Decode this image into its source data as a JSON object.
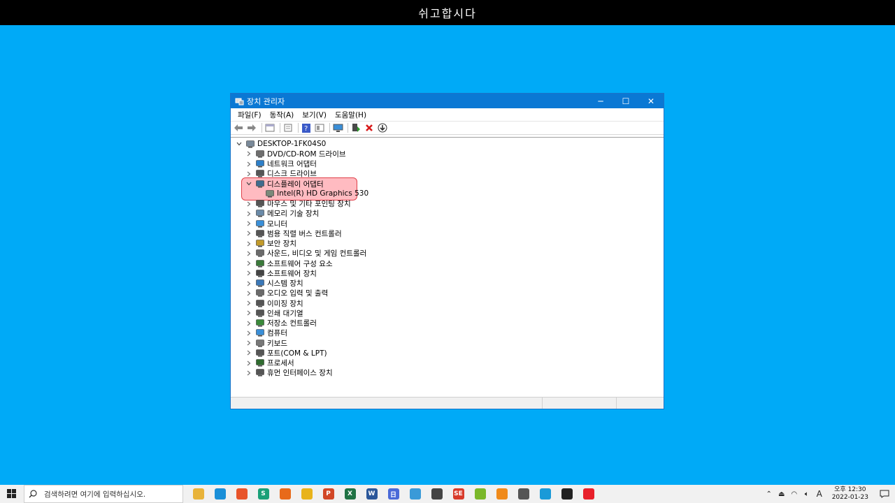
{
  "banner": {
    "text": "쉬고합시다"
  },
  "window": {
    "title": "장치 관리자",
    "controls": {
      "minimize": "─",
      "maximize": "☐",
      "close": "✕"
    }
  },
  "menu": [
    "파일(F)",
    "동작(A)",
    "보기(V)",
    "도움말(H)"
  ],
  "toolbar_icons": [
    "back-icon",
    "forward-icon",
    "show-hide-tree-icon",
    "properties-icon",
    "help-icon",
    "view-icon",
    "monitor-scan-icon",
    "update-driver-icon",
    "uninstall-icon",
    "download-icon"
  ],
  "tree": {
    "root": "DESKTOP-1FK04S0",
    "categories": [
      {
        "label": "DVD/CD-ROM 드라이브",
        "icon": "dvd-icon",
        "color": "#6e6e6e",
        "expanded": false
      },
      {
        "label": "네트워크 어댑터",
        "icon": "network-icon",
        "color": "#2d7fc8",
        "expanded": false
      },
      {
        "label": "디스크 드라이브",
        "icon": "disk-icon",
        "color": "#555555",
        "expanded": false
      },
      {
        "label": "디스플레이 어댑터",
        "icon": "display-adapter-icon",
        "color": "#3e6c8e",
        "expanded": true,
        "children": [
          "Intel(R) HD Graphics 530"
        ]
      },
      {
        "label": "마우스 및 기타 포인팅 장치",
        "icon": "mouse-icon",
        "color": "#555555",
        "expanded": false
      },
      {
        "label": "메모리 기술 장치",
        "icon": "memory-icon",
        "color": "#6a8aa8",
        "expanded": false
      },
      {
        "label": "모니터",
        "icon": "monitor-icon",
        "color": "#3a8fd8",
        "expanded": false
      },
      {
        "label": "범용 직렬 버스 컨트롤러",
        "icon": "usb-icon",
        "color": "#555555",
        "expanded": false
      },
      {
        "label": "보안 장치",
        "icon": "security-icon",
        "color": "#c29a2a",
        "expanded": false
      },
      {
        "label": "사운드, 비디오 및 게임 컨트롤러",
        "icon": "sound-icon",
        "color": "#6a6a6a",
        "expanded": false
      },
      {
        "label": "소프트웨어 구성 요소",
        "icon": "software-component-icon",
        "color": "#3a7a3a",
        "expanded": false
      },
      {
        "label": "소프트웨어 장치",
        "icon": "software-device-icon",
        "color": "#444444",
        "expanded": false
      },
      {
        "label": "시스템 장치",
        "icon": "system-icon",
        "color": "#3a78b8",
        "expanded": false
      },
      {
        "label": "오디오 입력 및 출력",
        "icon": "audio-icon",
        "color": "#6a6a6a",
        "expanded": false
      },
      {
        "label": "이미징 장치",
        "icon": "camera-icon",
        "color": "#555555",
        "expanded": false
      },
      {
        "label": "인쇄 대기열",
        "icon": "printer-icon",
        "color": "#555555",
        "expanded": false
      },
      {
        "label": "저장소 컨트롤러",
        "icon": "storage-icon",
        "color": "#3a8a3a",
        "expanded": false
      },
      {
        "label": "컴퓨터",
        "icon": "computer-icon",
        "color": "#3a8fd8",
        "expanded": false
      },
      {
        "label": "키보드",
        "icon": "keyboard-icon",
        "color": "#777777",
        "expanded": false
      },
      {
        "label": "포트(COM & LPT)",
        "icon": "port-icon",
        "color": "#555555",
        "expanded": false
      },
      {
        "label": "프로세서",
        "icon": "processor-icon",
        "color": "#2f6b2f",
        "expanded": false
      },
      {
        "label": "휴먼 인터페이스 장치",
        "icon": "hid-icon",
        "color": "#555555",
        "expanded": false
      }
    ]
  },
  "taskbar": {
    "search_placeholder": "검색하려면 여기에 입력하십시오.",
    "apps": [
      {
        "name": "file-explorer-icon",
        "color": "#e8b33a",
        "glyph": ""
      },
      {
        "name": "edge-icon",
        "color": "#1a8fd8",
        "glyph": ""
      },
      {
        "name": "brave-icon",
        "color": "#e8542a",
        "glyph": ""
      },
      {
        "name": "app-s-icon",
        "color": "#1aa078",
        "glyph": "S"
      },
      {
        "name": "firefox-icon",
        "color": "#e86a1a",
        "glyph": ""
      },
      {
        "name": "chrome-icon",
        "color": "#e8b31a",
        "glyph": ""
      },
      {
        "name": "powerpoint-icon",
        "color": "#d24726",
        "glyph": "P"
      },
      {
        "name": "excel-icon",
        "color": "#1f7244",
        "glyph": "X"
      },
      {
        "name": "word-icon",
        "color": "#2b579a",
        "glyph": "W"
      },
      {
        "name": "calendar-app-icon",
        "color": "#4a6ad8",
        "glyph": "日"
      },
      {
        "name": "remote-desktop-icon",
        "color": "#3a9ad8",
        "glyph": ""
      },
      {
        "name": "search-tool-icon",
        "color": "#444444",
        "glyph": ""
      },
      {
        "name": "app-se-icon",
        "color": "#d83a2a",
        "glyph": "SE"
      },
      {
        "name": "android-app-icon",
        "color": "#7ab82a",
        "glyph": ""
      },
      {
        "name": "vlc-icon",
        "color": "#f08a1a",
        "glyph": ""
      },
      {
        "name": "calculator-icon",
        "color": "#555555",
        "glyph": ""
      },
      {
        "name": "chrome-beta-icon",
        "color": "#1a9ad8",
        "glyph": ""
      },
      {
        "name": "notes-app-icon",
        "color": "#222222",
        "glyph": ""
      },
      {
        "name": "opera-icon",
        "color": "#e8202a",
        "glyph": ""
      }
    ],
    "tray": {
      "ime": "A",
      "time": "오후 12:30",
      "date": "2022-01-23"
    }
  }
}
